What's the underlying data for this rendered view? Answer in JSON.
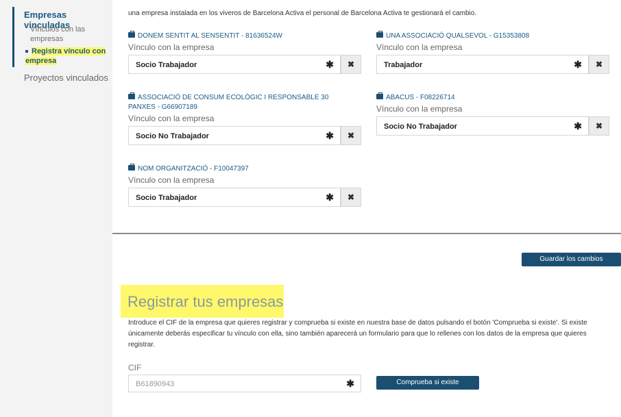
{
  "sidebar": {
    "section_title": "Empresas vinculadas",
    "items": [
      {
        "label": "Vínculos con las empresas"
      },
      {
        "label": "Registra vínculo con empresa"
      },
      {
        "label": "Proyectos vinculados"
      }
    ]
  },
  "main": {
    "intro_text": "una empresa instalada en los viveros de Barcelona Activa el personal de Barcelona Activa te gestionará el cambio.",
    "vinculo_label": "Vínculo con la empresa",
    "companies": [
      {
        "name": "DONEM SENTIT AL SENSENTIT - 81636524W",
        "value": "Socio Trabajador"
      },
      {
        "name": "UNA ASSOCIACIÓ QUALSEVOL - G15353808",
        "value": "Trabajador"
      },
      {
        "name": "ASSOCIACIÓ DE CONSUM ECOLÒGIC I RESPONSABLE 30 PANXES - G66907189",
        "value": "Socio No Trabajador"
      },
      {
        "name": "ABACUS - F08226714",
        "value": "Socio No Trabajador"
      },
      {
        "name": "NOM ORGANITZACIÓ - F10047397",
        "value": "Socio Trabajador"
      }
    ],
    "required_mark": "✱",
    "remove_mark": "✖",
    "save_button": "Guardar los cambios"
  },
  "register": {
    "title": "Registrar tus empresas",
    "description": "Introduce el CIF de la empresa que quieres registrar y comprueba si existe en nuestra base de datos pulsando el botón 'Comprueba si existe'. Si existe únicamente deberás especificar tu vínculo con ella, sino también aparecerá un formulario para que lo rellenes con los datos de la empresa que quieres registrar.",
    "cif_label": "CIF",
    "cif_placeholder": "B61890943",
    "check_button": "Comprueba si existe"
  },
  "colors": {
    "accent": "#1b4f72",
    "highlight": "#fff86b",
    "sidebar_bg": "#f3f3f3"
  },
  "icons": {
    "company": "briefcase-icon",
    "required": "asterisk-icon",
    "remove": "close-icon"
  }
}
